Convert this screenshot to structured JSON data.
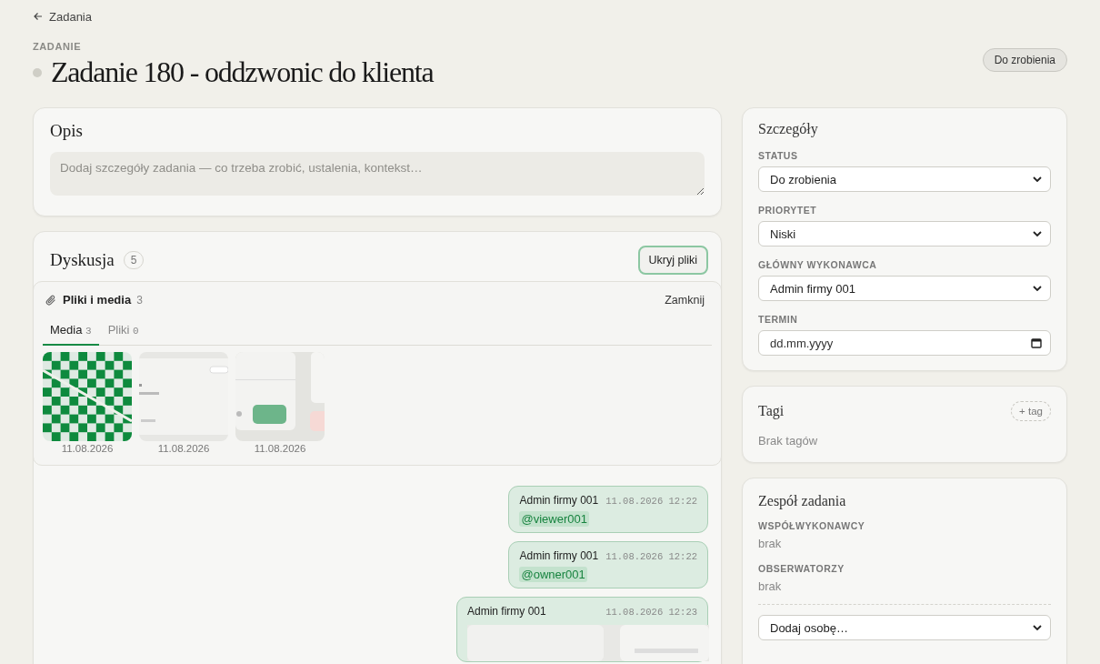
{
  "back_link": {
    "label": "Zadania"
  },
  "header": {
    "eyebrow": "ZADANIE",
    "title": "Zadanie 180 - oddzwonic do klienta",
    "status_badge": "Do zrobienia"
  },
  "description": {
    "title": "Opis",
    "placeholder": "Dodaj szczegóły zadania — co trzeba zrobić, ustalenia, kontekst…"
  },
  "discussion": {
    "title": "Dyskusja",
    "count": "5",
    "toggle_button": "Ukryj pliki",
    "files_panel": {
      "title": "Pliki i media",
      "count": "3",
      "close": "Zamknij",
      "tabs": [
        {
          "label": "Media",
          "count": "3",
          "selected": true
        },
        {
          "label": "Pliki",
          "count": "0",
          "selected": false
        }
      ],
      "media": [
        {
          "kind": "checker",
          "date": "11.08.2026"
        },
        {
          "kind": "screen",
          "date": "11.08.2026"
        },
        {
          "kind": "dialog",
          "date": "11.08.2026"
        }
      ]
    },
    "messages": [
      {
        "kind": "mention",
        "author": "Admin firmy 001",
        "time": "11.08.2026 12:22",
        "mention": "@viewer001"
      },
      {
        "kind": "mention",
        "author": "Admin firmy 001",
        "time": "11.08.2026 12:22",
        "mention": "@owner001"
      },
      {
        "kind": "attachment",
        "author": "Admin firmy 001",
        "time": "11.08.2026 12:23"
      }
    ]
  },
  "details": {
    "title": "Szczegóły",
    "fields": [
      {
        "kind": "select",
        "label": "STATUS",
        "value": "Do zrobienia"
      },
      {
        "kind": "select",
        "label": "PRIORYTET",
        "value": "Niski"
      },
      {
        "kind": "select",
        "label": "GŁÓWNY WYKONAWCA",
        "value": "Admin firmy 001"
      },
      {
        "kind": "date",
        "label": "TERMIN",
        "placeholder": "dd.mm.yyyy"
      }
    ]
  },
  "tags": {
    "title": "Tagi",
    "add_button": "+ tag",
    "empty": "Brak tagów"
  },
  "team": {
    "title": "Zespół zadania",
    "groups": [
      {
        "label": "WSPÓŁWYKONAWCY",
        "empty": "brak"
      },
      {
        "label": "OBSERWATORZY",
        "empty": "brak"
      }
    ],
    "add_select": "Dodaj osobę…"
  }
}
